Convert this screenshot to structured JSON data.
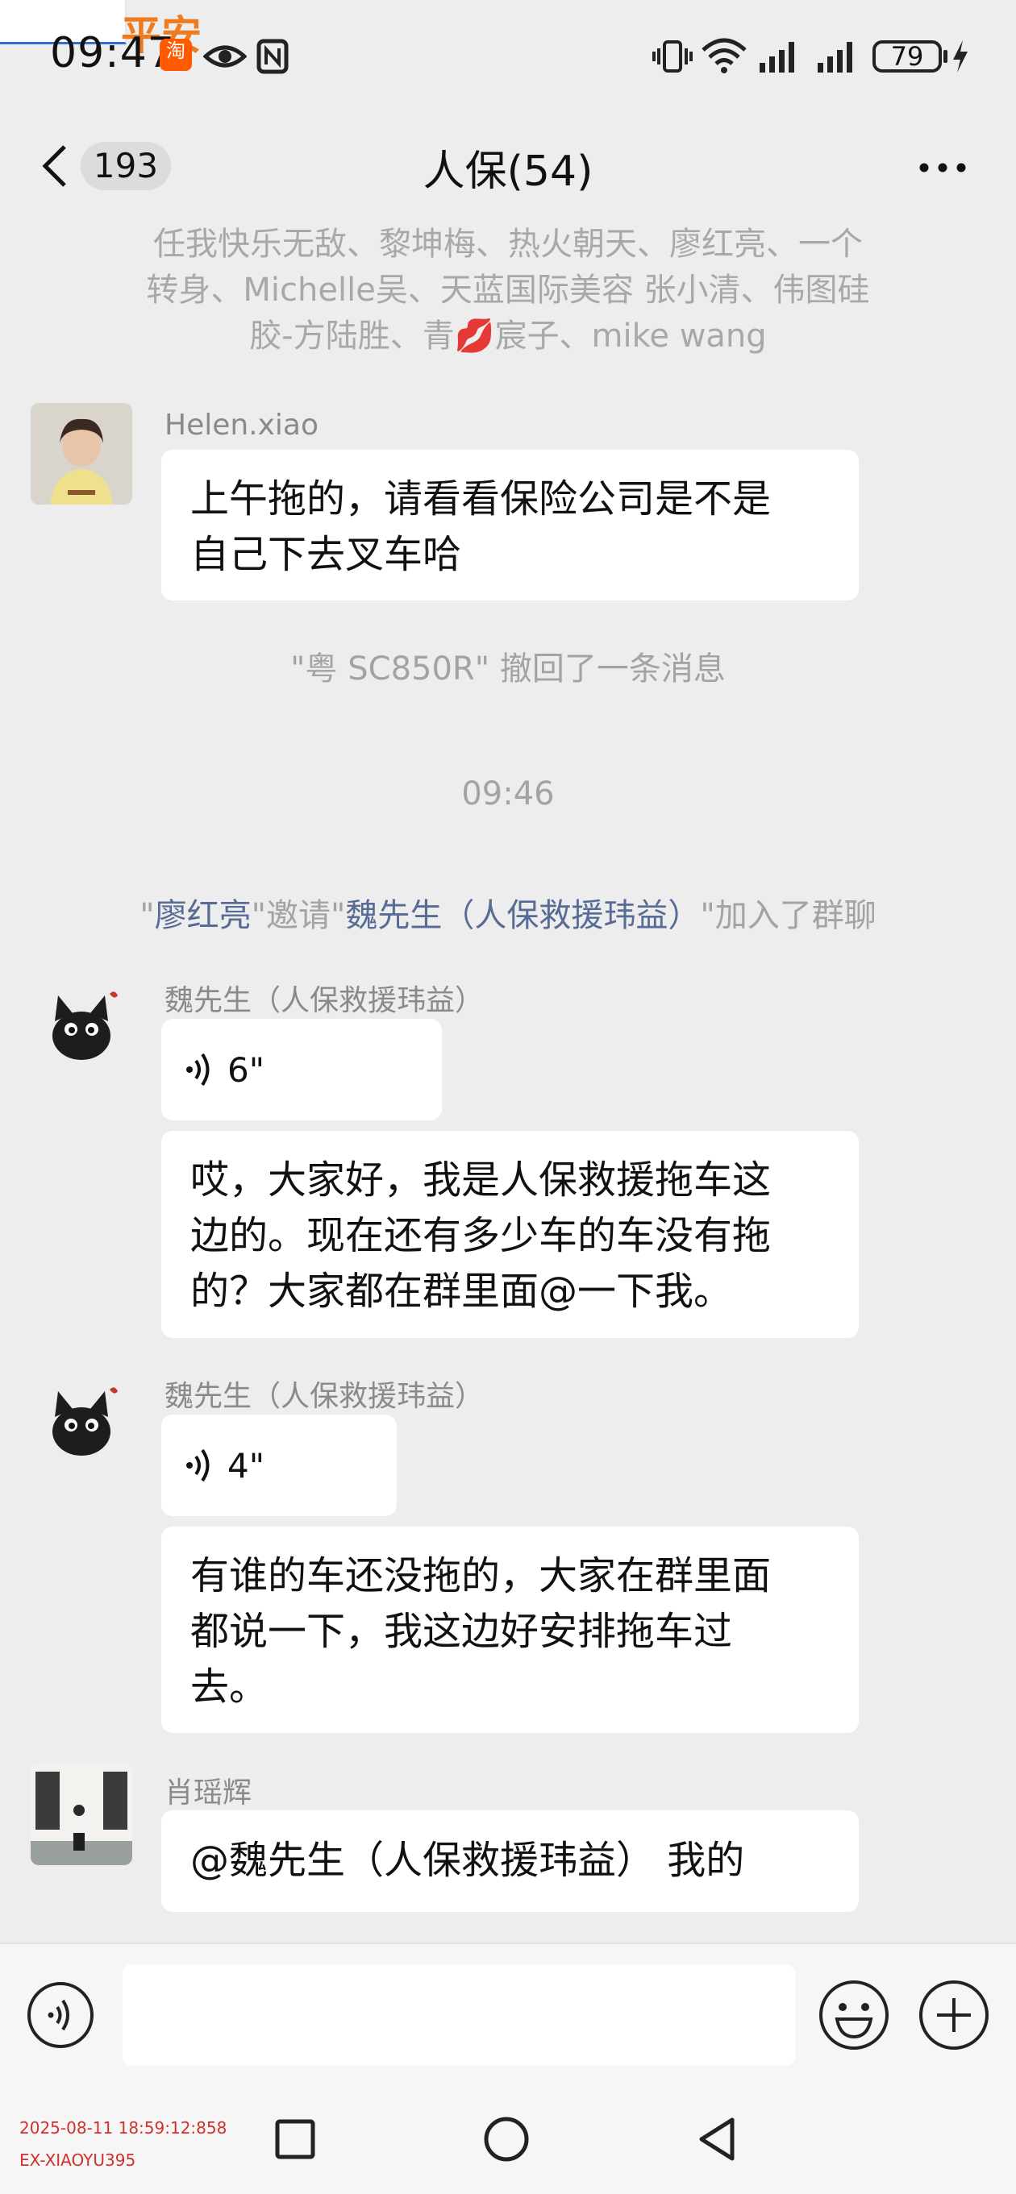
{
  "status_bar": {
    "time": "09:47",
    "watermark_text": "平安",
    "taobao_label": "淘",
    "battery_level": "79",
    "icons": [
      "eye-icon",
      "nfc-icon",
      "vibrate-icon",
      "wifi-icon",
      "signal-icon",
      "battery-icon",
      "charging-bolt-icon"
    ]
  },
  "header": {
    "back_icon": "chevron-left-icon",
    "unread_count": "193",
    "title": "人保(54)",
    "more_icon": "more-dots-icon"
  },
  "group_members_line": {
    "line1": "任我快乐无敌、黎坤梅、热火朝天、廖红亮、一个",
    "line2": "转身、Michelle吴、天蓝国际美容  张小清、伟图硅",
    "line3_before_emoji": "胶-方陆胜、青",
    "emoji": "💋",
    "line3_after_emoji": "宸子、mike wang"
  },
  "messages": [
    {
      "type": "text",
      "sender": "Helen.xiao",
      "line1": "上午拖的，请看看保险公司是不是",
      "line2": "自己下去叉车哈"
    },
    {
      "type": "system",
      "text": "\"粤 SC850R\" 撤回了一条消息"
    },
    {
      "type": "time",
      "text": "09:46"
    },
    {
      "type": "invite",
      "quote_open": "\"",
      "inviter": "廖红亮",
      "middle": "\"邀请\"",
      "invitee": "魏先生（人保救援玮益）",
      "suffix": "\"加入了群聊"
    },
    {
      "type": "voice",
      "sender": "魏先生（人保救援玮益）",
      "duration": "6\""
    },
    {
      "type": "text",
      "line1": "哎，大家好，我是人保救援拖车这",
      "line2": "边的。现在还有多少车的车没有拖",
      "line3": "的？大家都在群里面@一下我。"
    },
    {
      "type": "voice",
      "sender": "魏先生（人保救援玮益）",
      "duration": "4\""
    },
    {
      "type": "text",
      "line1": "有谁的车还没拖的，大家在群里面",
      "line2": "都说一下，我这边好安排拖车过",
      "line3": "去。"
    },
    {
      "type": "text",
      "sender": "肖瑶辉",
      "line1": "@魏先生（人保救援玮益） 我的"
    }
  ],
  "input_bar": {
    "voice_icon": "voice-mode-icon",
    "emoji_icon": "emoji-icon",
    "plus_icon": "plus-circle-icon",
    "input_value": ""
  },
  "overlay": {
    "timestamp": "2025-08-11 18:59:12:858",
    "user_code": "EX-XIAOYU395"
  },
  "system_nav": {
    "icons": [
      "recents-square-icon",
      "home-circle-icon",
      "back-triangle-icon"
    ]
  },
  "colors": {
    "chat_background": "#ededed",
    "bubble": "#ffffff",
    "system_text": "#a3a3a3",
    "link_name": "#576b95",
    "overlay_red": "#d0312d"
  }
}
